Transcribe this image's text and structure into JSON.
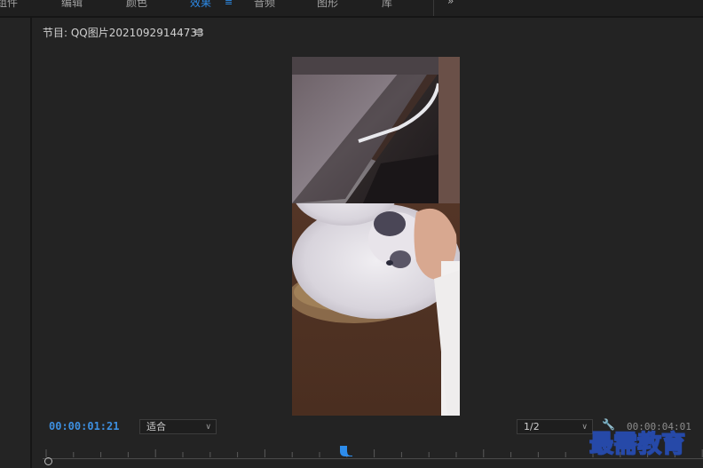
{
  "workspace_tabs": [
    {
      "label": "组件",
      "active": false
    },
    {
      "label": "编辑",
      "active": false
    },
    {
      "label": "颜色",
      "active": false
    },
    {
      "label": "效果",
      "active": true
    },
    {
      "label": "音频",
      "active": false
    },
    {
      "label": "图形",
      "active": false
    },
    {
      "label": "库",
      "active": false
    }
  ],
  "workspace_menu_glyph": "≡",
  "workspace_more_glyph": "»",
  "monitor": {
    "title": "节目: QQ图片20210929144733",
    "menu_glyph": "≡",
    "timecode": "00:00:01:21",
    "fit_option": "适合",
    "resolution_option": "1/2",
    "duration": "00:00:04:01"
  },
  "icons": {
    "dropdown_caret": "chevron-down-icon",
    "settings": "wrench-icon",
    "playhead": "playhead-icon",
    "in_point": "in-point-icon"
  },
  "colors": {
    "accent": "#2d8ceb",
    "timecode": "#3d8fe0",
    "panel_bg": "#232323"
  },
  "watermark": "最需教育"
}
